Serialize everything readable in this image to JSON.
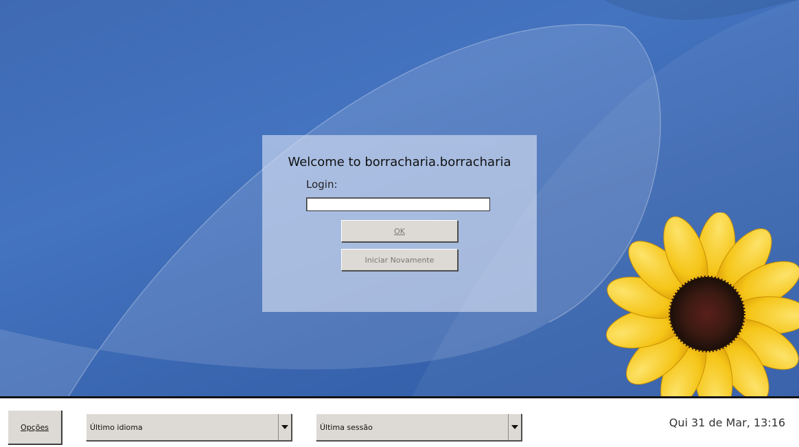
{
  "login": {
    "title": "Welcome to borracharia.borracharia",
    "label": "Login:",
    "input_value": "",
    "ok_label": "OK",
    "restart_label": "Iniciar Novamente"
  },
  "taskbar": {
    "options_label": "Opções",
    "language_value": "Último idioma",
    "session_value": "Última sessão",
    "clock": "Qui 31 de Mar, 13:16"
  },
  "colors": {
    "wallpaper_blue": "#3f6ab3",
    "panel": "#dae2f3",
    "button_gray": "#dddad5",
    "petal_yellow": "#f5c518",
    "center_dark": "#3a1a12"
  }
}
